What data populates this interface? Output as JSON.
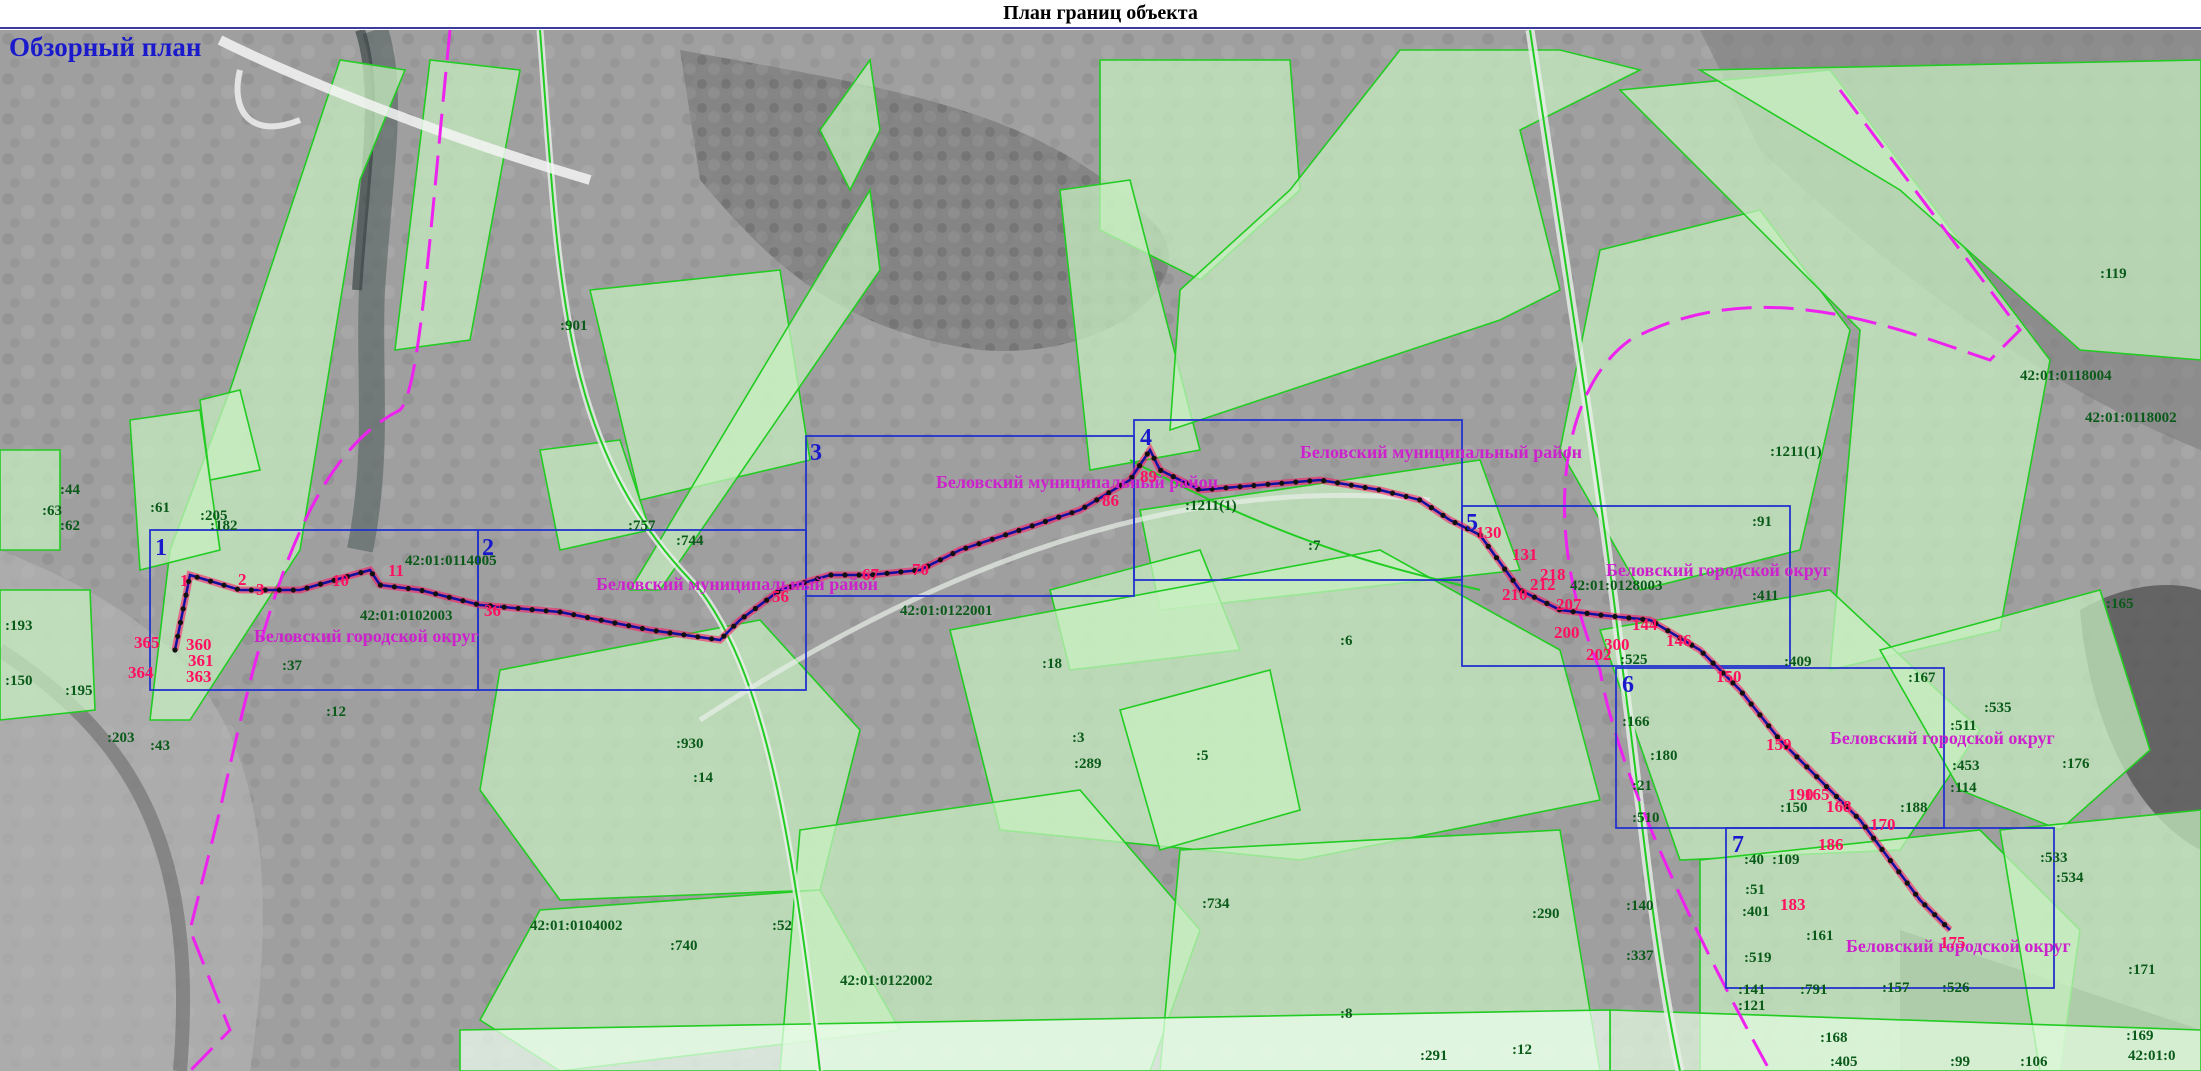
{
  "page_title": "План границ объекта",
  "overview_title": "Обзорный план",
  "colors": {
    "parcel_fill": "#c8f0c0",
    "parcel_stroke": "#22cc22",
    "boundary_dash": "#ee22ee",
    "sheet_frame": "#2233cc",
    "route_line": "#1010a0",
    "point_label": "#ff1060",
    "district_label": "#cc22cc",
    "cadastre_label": "#0a5a1a"
  },
  "sheet_numbers": [
    "1",
    "2",
    "3",
    "4",
    "5",
    "6",
    "7"
  ],
  "district_labels": [
    "Беловский муниципальный район",
    "Беловский муниципальный район",
    "Беловский муниципальный район",
    "Беловский городской округ",
    "Беловский городской округ",
    "Беловский городской округ",
    "Беловский городской округ"
  ],
  "cadastre_labels": [
    "42:01:0114005",
    "42:01:0102003",
    "42:01:0122001",
    "42:01:0104002",
    "42:01:0122002",
    "42:01:0118004",
    "42:01:0118002",
    "42:01:0128003",
    "42:01:0",
    ":901",
    ":757",
    ":744",
    ":7",
    ":61",
    ":205",
    ":182",
    ":63",
    ":44",
    ":62",
    ":193",
    ":150",
    ":195",
    ":203",
    ":43",
    ":37",
    ":12",
    ":930",
    ":14",
    ":18",
    ":6",
    ":3",
    ":289",
    ":5",
    ":740",
    ":52",
    ":734",
    ":290",
    ":8",
    ":291",
    ":12",
    ":91",
    ":411",
    ":165",
    ":119",
    ":409",
    ":525",
    ":167",
    ":535",
    ":511",
    ":453",
    ":176",
    ":166",
    ":180",
    ":21",
    ":510",
    ":150",
    ":188",
    ":114",
    ":140",
    ":337",
    ":533",
    ":534",
    ":171",
    ":169",
    ":168",
    ":405",
    ":99",
    ":106",
    ":40",
    ":109",
    ":51",
    ":401",
    ":161",
    ":519",
    ":141",
    ":121",
    ":791",
    ":157",
    ":526",
    ":1211(1)",
    ":1211(1)"
  ],
  "point_labels": [
    "1",
    "2",
    "3",
    "10",
    "11",
    "36",
    "56",
    "67",
    "70",
    "86",
    "89",
    "130",
    "131",
    "144",
    "146",
    "150",
    "159",
    "165",
    "168",
    "170",
    "175",
    "183",
    "186",
    "190",
    "200",
    "202",
    "210",
    "300",
    "360",
    "361",
    "363",
    "364",
    "365",
    "218",
    "212",
    "207"
  ]
}
